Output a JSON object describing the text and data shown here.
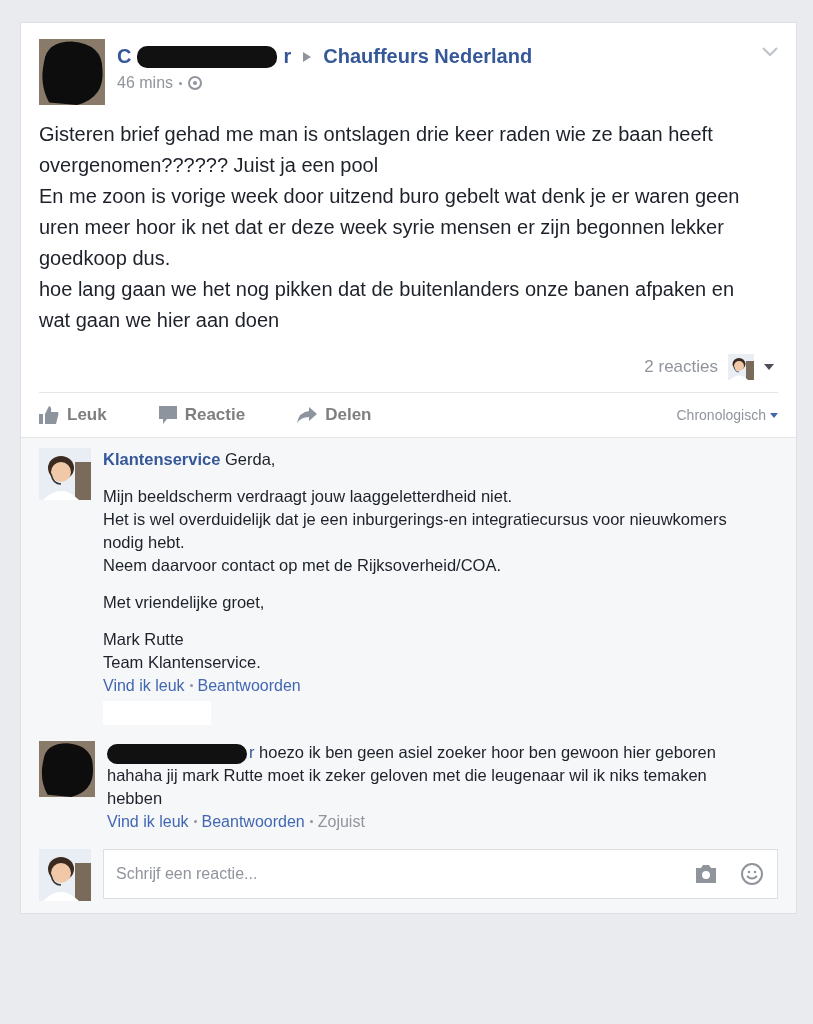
{
  "post": {
    "author": {
      "name_start": "C",
      "name_end": "r"
    },
    "group": "Chauffeurs Nederland",
    "time": "46 mins",
    "paragraphs": [
      "Gisteren brief gehad me man is ontslagen drie keer raden wie ze baan heeft overgenomen?????? Juist ja een pool",
      "En me zoon is vorige week door uitzend buro gebelt wat denk je er waren geen uren meer hoor ik net dat er deze week syrie mensen er zijn begonnen lekker goedkoop dus.",
      "hoe lang gaan we het nog pikken dat de buitenlanders onze banen afpaken en wat gaan we hier aan doen"
    ],
    "reaction_count": "2 reacties"
  },
  "actions": [
    {
      "kind": "like",
      "label": "Leuk"
    },
    {
      "kind": "comment",
      "label": "Reactie"
    },
    {
      "kind": "share",
      "label": "Delen"
    }
  ],
  "sort": "Chronologisch",
  "comments": [
    {
      "redacted_avatar": false,
      "author": "Klantenservice",
      "lead": "Gerda,",
      "blocks": [
        [
          "Mijn beeldscherm verdraagt jouw laaggeletterdheid niet.",
          "Het is wel overduidelijk dat je een inburgerings-en integratiecursus voor nieuwkomers nodig hebt.",
          "Neem daarvoor contact op met de Rijksoverheid/COA."
        ],
        [
          "Met vriendelijke groet,"
        ],
        [
          "Mark Rutte",
          "Team Klantenservice."
        ]
      ],
      "like": "Vind ik leuk",
      "reply": "Beantwoorden",
      "redacted_below": true
    },
    {
      "redacted_avatar": true,
      "author": "r",
      "lead": "hoezo ik ben geen asiel zoeker hoor ben gewoon hier geboren",
      "blocks": [
        [
          "hahaha jij mark Rutte moet ik zeker geloven met die leugenaar wil ik niks temaken hebben"
        ]
      ],
      "like": "Vind ik leuk",
      "reply": "Beantwoorden",
      "time": "Zojuist",
      "redacted_below": false
    }
  ],
  "composer": {
    "placeholder": "Schrijf een reactie..."
  }
}
